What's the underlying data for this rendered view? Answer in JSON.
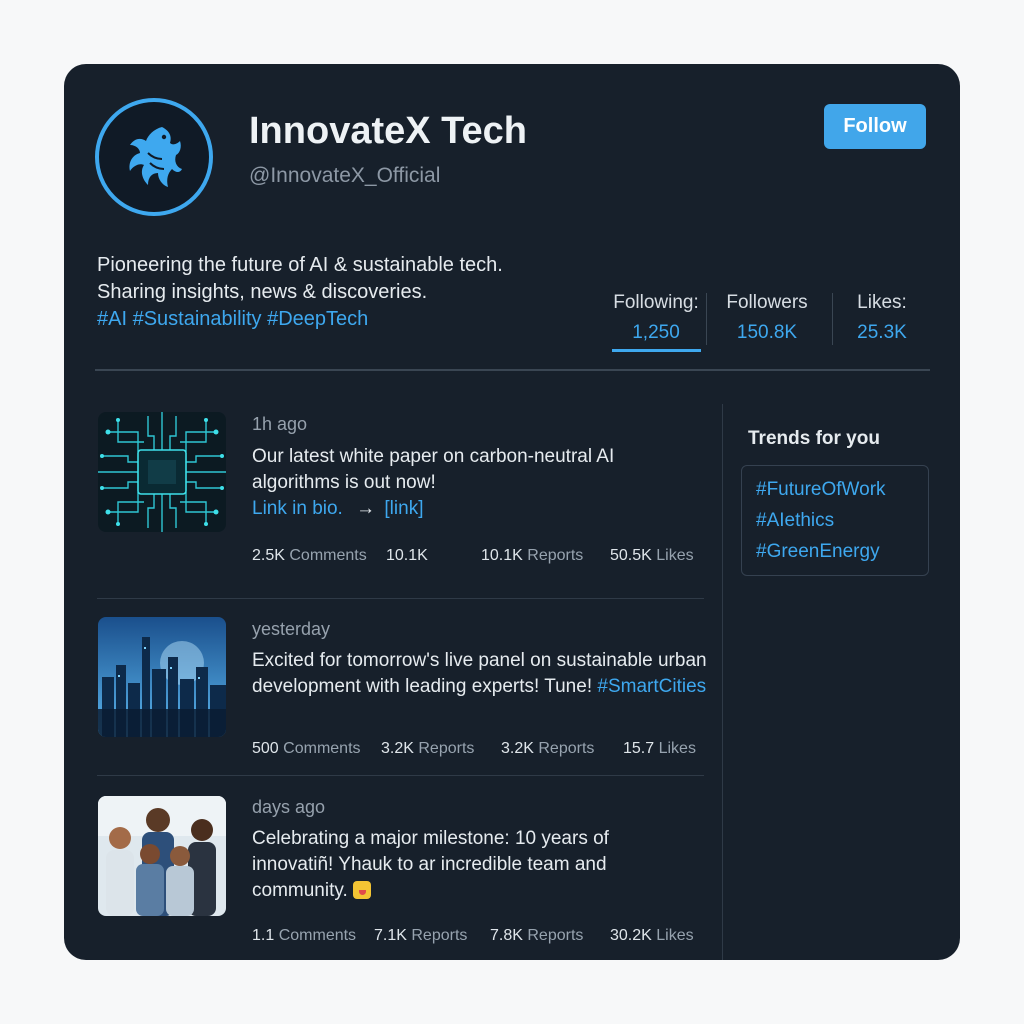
{
  "profile": {
    "name": "InnovateX Tech",
    "handle": "@InnovateX_Official",
    "follow_label": "Follow",
    "bio_line1": "Pioneering the future of AI & sustainable tech.",
    "bio_line2": "Sharing insights, news & discoveries.",
    "bio_tags": "#AI #Sustainability #DeepTech",
    "avatar_icon": "phoenix-icon",
    "accent_color": "#3ea8ef"
  },
  "stats": {
    "following_label": "Following:",
    "following_value": "1,250",
    "followers_label": "Followers",
    "followers_value": "150.8K",
    "likes_label": "Likes:",
    "likes_value": "25.3K"
  },
  "posts": [
    {
      "time": "1h ago",
      "text_line1": "Our latest white paper on carbon-neutral AI",
      "text_line2": "algorithms is out now!",
      "link_text": "Link in bio.",
      "arrow": "→",
      "link2": "[link]",
      "stats": [
        {
          "value": "2.5K",
          "label": "Comments"
        },
        {
          "value": "10.1K",
          "label": ""
        },
        {
          "value": "10.1K",
          "label": "Reports"
        },
        {
          "value": "50.5K",
          "label": "Likes"
        }
      ]
    },
    {
      "time": "yesterday",
      "text_line1": "Excited for tomorrow's live panel on sustainable urban",
      "text_line2": "development with leading experts! Tune!",
      "hashtag": "#SmartCities",
      "stats": [
        {
          "value": "500",
          "label": "Comments"
        },
        {
          "value": "3.2K",
          "label": "Reports"
        },
        {
          "value": "3.2K",
          "label": "Reports"
        },
        {
          "value": "15.7",
          "label": "Likes"
        }
      ]
    },
    {
      "time": "days ago",
      "text_line1": "Celebrating a major milestone: 10 years of",
      "text_line2": "innovatiñ! Yhauk to ar incredible team and",
      "text_line3": "community.",
      "stats": [
        {
          "value": "1.1",
          "label": "Comments"
        },
        {
          "value": "7.1K",
          "label": "Reports"
        },
        {
          "value": "7.8K",
          "label": "Reports"
        },
        {
          "value": "30.2K",
          "label": "Likes"
        }
      ]
    }
  ],
  "trends": {
    "title": "Trends for you",
    "items": [
      "#FutureOfWork",
      "#AIethics",
      "#GreenEnergy"
    ]
  }
}
